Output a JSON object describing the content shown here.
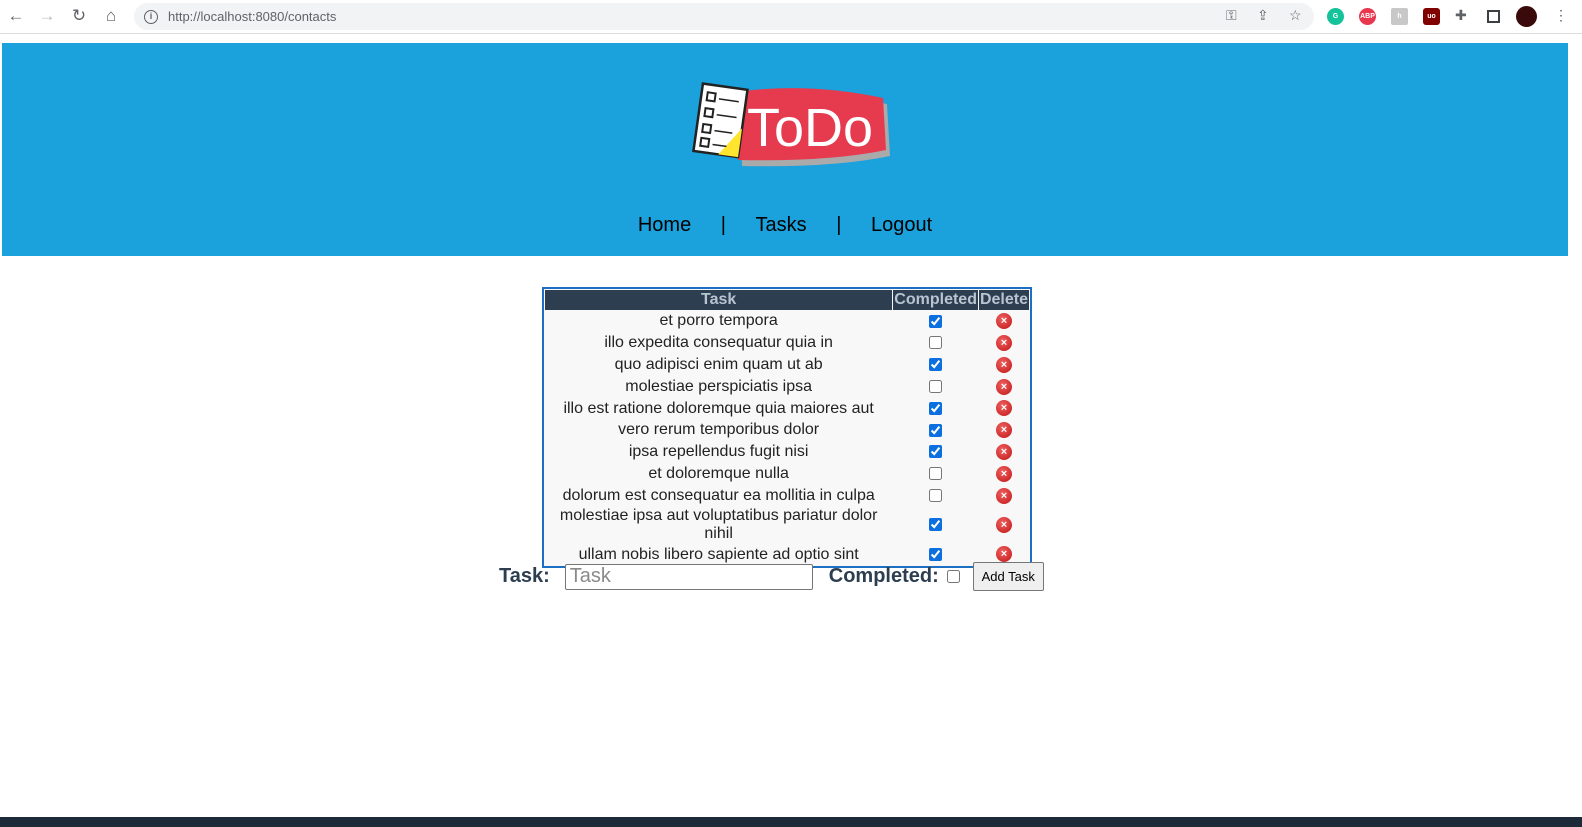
{
  "browser": {
    "url_host": "http://localhost",
    "url_rest": ":8080/contacts"
  },
  "nav": {
    "home": "Home",
    "sep": "|",
    "tasks": "Tasks",
    "logout": "Logout"
  },
  "logo_text": "ToDo",
  "table": {
    "headers": [
      "Task",
      "Completed",
      "Delete"
    ],
    "rows": [
      {
        "task": "et porro tempora",
        "completed": true
      },
      {
        "task": "illo expedita consequatur quia in",
        "completed": false
      },
      {
        "task": "quo adipisci enim quam ut ab",
        "completed": true
      },
      {
        "task": "molestiae perspiciatis ipsa",
        "completed": false
      },
      {
        "task": "illo est ratione doloremque quia maiores aut",
        "completed": true
      },
      {
        "task": "vero rerum temporibus dolor",
        "completed": true
      },
      {
        "task": "ipsa repellendus fugit nisi",
        "completed": true
      },
      {
        "task": "et doloremque nulla",
        "completed": false
      },
      {
        "task": "dolorum est consequatur ea mollitia in culpa",
        "completed": false
      },
      {
        "task": "molestiae ipsa aut voluptatibus pariatur dolor nihil",
        "completed": true
      },
      {
        "task": "ullam nobis libero sapiente ad optio sint",
        "completed": true
      }
    ]
  },
  "form": {
    "task_label": "Task:",
    "task_placeholder": "Task",
    "task_value": "",
    "completed_label": "Completed:",
    "completed": false,
    "add_button": "Add Task"
  },
  "colors": {
    "header_bg": "#1ba1db",
    "table_header": "#2c3e50",
    "border": "#1c6fc2"
  }
}
